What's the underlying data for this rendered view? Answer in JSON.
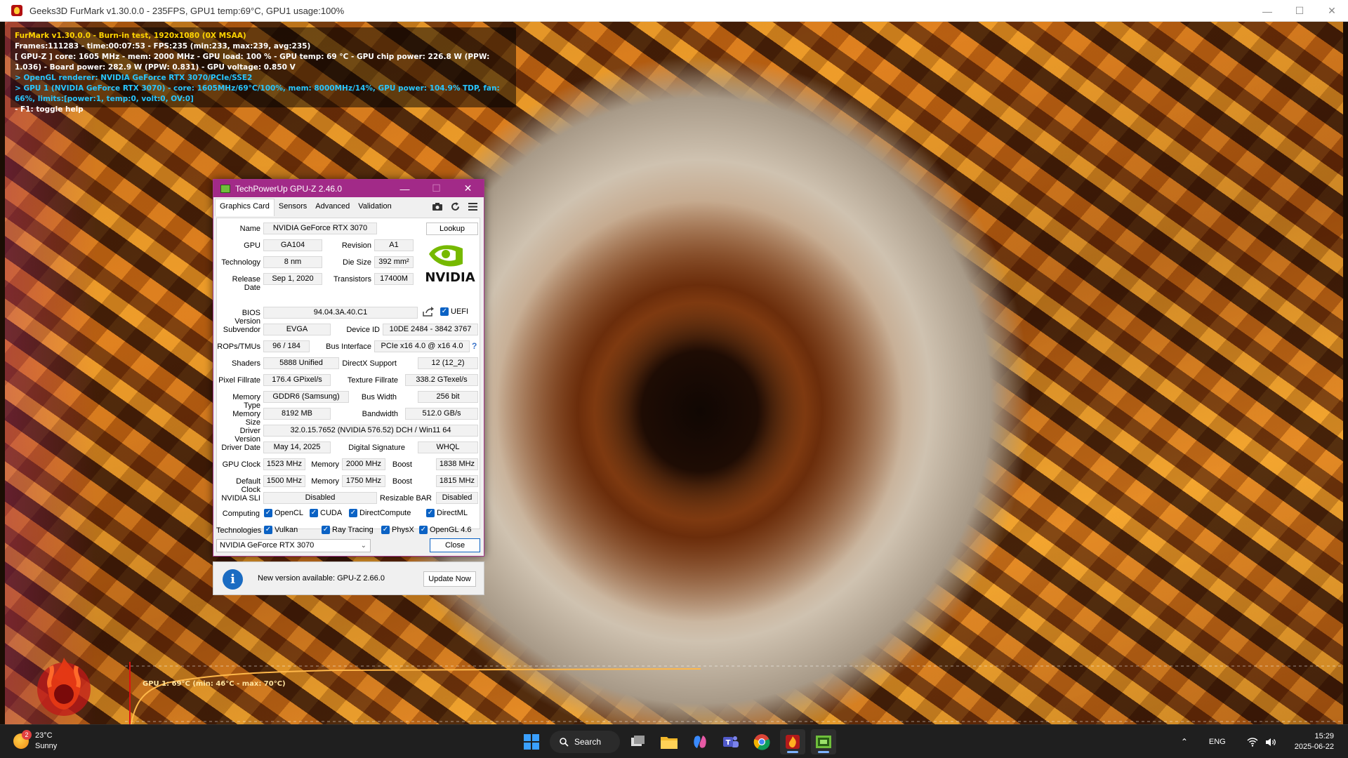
{
  "furmark": {
    "window_title": "Geeks3D FurMark v1.30.0.0 - 235FPS, GPU1 temp:69°C, GPU1 usage:100%",
    "hud": [
      "FurMark v1.30.0.0 - Burn-in test, 1920x1080 (0X MSAA)",
      "Frames:111283 - time:00:07:53 - FPS:235 (min:233, max:239, avg:235)",
      "[ GPU-Z ] core: 1605 MHz - mem: 2000 MHz - GPU load: 100 % - GPU temp: 69 °C - GPU chip power: 226.8 W (PPW: 1.036) - Board power: 282.9 W (PPW: 0.831) - GPU voltage: 0.850 V",
      "> OpenGL renderer: NVIDIA GeForce RTX 3070/PCIe/SSE2",
      "> GPU 1 (NVIDIA GeForce RTX 3070) - core: 1605MHz/69°C/100%, mem: 8000MHz/14%, GPU power: 104.9% TDP, fan: 66%, limits:[power:1, temp:0, volt:0, OV:0]",
      "- F1: toggle help"
    ],
    "temp_graph_label": "GPU 1: 69°C (min: 46°C - max: 70°C)",
    "colors": {
      "hud_yellow": "#ffd400",
      "hud_cyan": "#27c6ff",
      "graph_line": "#ffb84a"
    }
  },
  "gpuz": {
    "title": "TechPowerUp GPU-Z 2.46.0",
    "tabs": [
      "Graphics Card",
      "Sensors",
      "Advanced",
      "Validation"
    ],
    "tools": [
      "camera-icon",
      "refresh-icon",
      "menu-icon"
    ],
    "lookup_label": "Lookup",
    "labels": {
      "name": "Name",
      "gpu": "GPU",
      "revision": "Revision",
      "technology": "Technology",
      "die_size": "Die Size",
      "release_date": "Release Date",
      "transistors": "Transistors",
      "bios_version": "BIOS Version",
      "uefi": "UEFI",
      "subvendor": "Subvendor",
      "device_id": "Device ID",
      "rops_tmus": "ROPs/TMUs",
      "bus_interface": "Bus Interface",
      "shaders": "Shaders",
      "directx": "DirectX Support",
      "pixel_fillrate": "Pixel Fillrate",
      "texture_fillrate": "Texture Fillrate",
      "memory_type": "Memory Type",
      "bus_width": "Bus Width",
      "memory_size": "Memory Size",
      "bandwidth": "Bandwidth",
      "driver_version": "Driver Version",
      "driver_date": "Driver Date",
      "digital_signature": "Digital Signature",
      "gpu_clock": "GPU Clock",
      "memory": "Memory",
      "boost": "Boost",
      "default_clock": "Default Clock",
      "nvidia_sli": "NVIDIA SLI",
      "resizable_bar": "Resizable BAR",
      "computing": "Computing",
      "technologies": "Technologies"
    },
    "values": {
      "name": "NVIDIA GeForce RTX 3070",
      "gpu": "GA104",
      "revision": "A1",
      "technology": "8 nm",
      "die_size": "392 mm²",
      "release_date": "Sep 1, 2020",
      "transistors": "17400M",
      "bios_version": "94.04.3A.40.C1",
      "subvendor": "EVGA",
      "device_id": "10DE 2484 - 3842 3767",
      "rops_tmus": "96 / 184",
      "bus_interface": "PCIe x16 4.0 @ x16 4.0",
      "shaders": "5888 Unified",
      "directx": "12 (12_2)",
      "pixel_fillrate": "176.4 GPixel/s",
      "texture_fillrate": "338.2 GTexel/s",
      "memory_type": "GDDR6 (Samsung)",
      "bus_width": "256 bit",
      "memory_size": "8192 MB",
      "bandwidth": "512.0 GB/s",
      "driver_version": "32.0.15.7652 (NVIDIA 576.52) DCH / Win11 64",
      "driver_date": "May 14, 2025",
      "digital_signature": "WHQL",
      "gpu_clock": "1523 MHz",
      "gpu_memory": "2000 MHz",
      "gpu_boost": "1838 MHz",
      "default_clock": "1500 MHz",
      "default_memory": "1750 MHz",
      "default_boost": "1815 MHz",
      "nvidia_sli": "Disabled",
      "resizable_bar": "Disabled"
    },
    "computing": [
      "OpenCL",
      "CUDA",
      "DirectCompute",
      "DirectML"
    ],
    "technologies": [
      "Vulkan",
      "Ray Tracing",
      "PhysX",
      "OpenGL 4.6"
    ],
    "selected_card": "NVIDIA GeForce RTX 3070",
    "close_label": "Close",
    "brand_logo_text": "NVIDIA",
    "accent": "#a22a88"
  },
  "update": {
    "message": "New version available: GPU-Z 2.66.0",
    "button": "Update Now"
  },
  "taskbar": {
    "weather_temp": "23°C",
    "weather_desc": "Sunny",
    "weather_badge": "2",
    "search_label": "Search",
    "language": "ENG",
    "time": "15:29",
    "date": "2025-06-22"
  }
}
